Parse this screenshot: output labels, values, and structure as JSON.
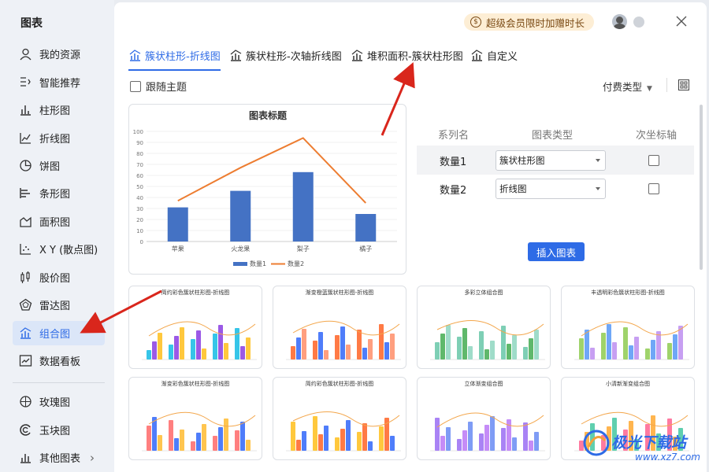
{
  "sidebar": {
    "title": "图表",
    "items": [
      {
        "label": "我的资源",
        "icon": "user-icon"
      },
      {
        "label": "智能推荐",
        "icon": "smart-icon"
      },
      {
        "label": "柱形图",
        "icon": "bar-chart-icon"
      },
      {
        "label": "折线图",
        "icon": "line-chart-icon"
      },
      {
        "label": "饼图",
        "icon": "pie-chart-icon"
      },
      {
        "label": "条形图",
        "icon": "hbar-chart-icon"
      },
      {
        "label": "面积图",
        "icon": "area-chart-icon"
      },
      {
        "label": "X Y (散点图)",
        "icon": "scatter-chart-icon"
      },
      {
        "label": "股价图",
        "icon": "stock-chart-icon"
      },
      {
        "label": "雷达图",
        "icon": "radar-chart-icon"
      },
      {
        "label": "组合图",
        "icon": "combo-chart-icon",
        "active": true
      },
      {
        "label": "数据看板",
        "icon": "dashboard-icon"
      },
      {
        "label": "玫瑰图",
        "icon": "rose-chart-icon"
      },
      {
        "label": "玉块图",
        "icon": "jade-chart-icon"
      },
      {
        "label": "其他图表",
        "icon": "more-chart-icon"
      }
    ]
  },
  "header": {
    "vip_text": "超级会员限时加赠时长"
  },
  "tabs": [
    {
      "label": "簇状柱形-折线图",
      "active": true
    },
    {
      "label": "簇状柱形-次轴折线图"
    },
    {
      "label": "堆积面积-簇状柱形图"
    },
    {
      "label": "自定义"
    }
  ],
  "toolbar": {
    "follow_theme": "跟随主题",
    "paid_type": "付费类型"
  },
  "series_table": {
    "headers": [
      "系列名",
      "图表类型",
      "次坐标轴"
    ],
    "rows": [
      {
        "name": "数量1",
        "type": "簇状柱形图"
      },
      {
        "name": "数量2",
        "type": "折线图"
      }
    ],
    "insert_label": "插入图表"
  },
  "thumbnails": [
    "简约彩色簇状柱形图-折线图",
    "渐变橙蓝簇状柱形图-折线图",
    "多彩立体组合图",
    "丰透明彩色簇状柱形图-折线图",
    "渐变彩色簇状柱形图-折线图",
    "简约彩色簇状柱形图-折线图",
    "立体渐变组合图",
    "小清新渐变组合图"
  ],
  "watermark": {
    "text": "极光下载站",
    "url": "www.xz7.com"
  },
  "colors": {
    "accent": "#2e6be6",
    "bar": "#4472c4",
    "line": "#ed7d31"
  },
  "chart_data": {
    "type": "bar",
    "title": "图表标题",
    "categories": [
      "苹果",
      "火龙果",
      "梨子",
      "橘子"
    ],
    "ylim": [
      0,
      100
    ],
    "yticks": [
      0,
      10,
      20,
      30,
      40,
      50,
      60,
      70,
      80,
      90,
      100
    ],
    "series": [
      {
        "name": "数量1",
        "kind": "bar",
        "values": [
          31,
          46,
          63,
          25
        ]
      },
      {
        "name": "数量2",
        "kind": "line",
        "values": [
          37,
          67,
          94,
          35
        ]
      }
    ],
    "legend": "bottom"
  }
}
